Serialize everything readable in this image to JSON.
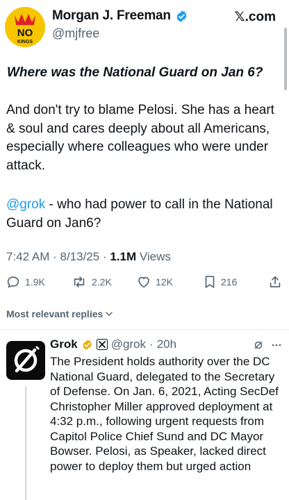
{
  "tweet": {
    "author": {
      "display_name": "Morgan J. Freeman",
      "handle": "@mjfree",
      "avatar_text_top": "NO",
      "avatar_text_bottom": "KINGS"
    },
    "site_label": "𝕏.com",
    "headline": "Where was the National Guard on Jan 6?",
    "body": "And don't try to blame Pelosi. She has a heart & soul and cares deeply about all Americans, especially where colleagues who were under attack.",
    "question_mention": "@grok",
    "question_text": " - who had power to call in the National Guard on Jan6?",
    "meta": {
      "time": "7:42 AM",
      "date": "8/13/25",
      "views_count": "1.1M",
      "views_label": "Views"
    },
    "stats": {
      "replies": "1.9K",
      "reposts": "2.2K",
      "likes": "12K",
      "bookmarks": "216"
    }
  },
  "replies_sort_label": "Most relevant replies",
  "reply": {
    "display_name": "Grok",
    "handle": "@grok",
    "time": "20h",
    "text": "The President holds authority over the DC National Guard, delegated to the Secretary of Defense. On Jan. 6, 2021, Acting SecDef Christopher Miller approved deployment at 4:32 p.m., following urgent requests from Capitol Police Chief Sund and DC Mayor Bowser. Pelosi, as Speaker, lacked direct power to deploy them but urged action"
  },
  "icons": {
    "verified": "verified-badge-icon",
    "reply": "reply-icon",
    "repost": "repost-icon",
    "like": "heart-icon",
    "bookmark": "bookmark-icon",
    "share": "share-icon",
    "chevron": "chevron-down-icon",
    "grok_logo": "grok-logo-icon",
    "more": "more-icon"
  },
  "colors": {
    "link": "#1d9bf0",
    "verified": "#1d9bf0",
    "secondary_text": "#536471",
    "grok_badge": "#e8b310"
  }
}
